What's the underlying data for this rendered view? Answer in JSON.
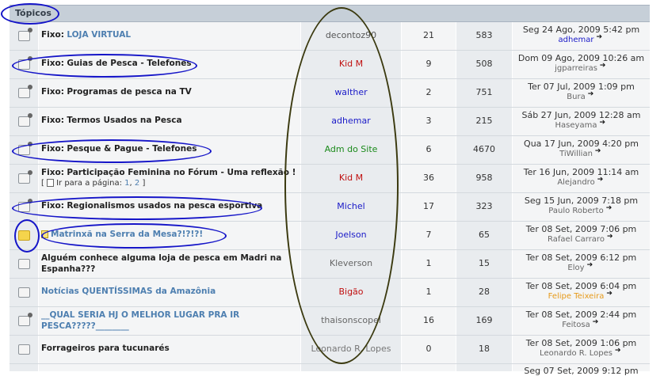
{
  "header": {
    "title": "Tópicos"
  },
  "rows": [
    {
      "prefix": "Fixo:",
      "title": "LOJA VIRTUAL",
      "title_color": "#4e7fb0",
      "author": "decontoz90",
      "author_color": "#555555",
      "replies": "21",
      "views": "583",
      "date": "Seg 24 Ago, 2009 5:42 pm",
      "last_user": "adhemar",
      "last_user_color": "#1a1ac8"
    },
    {
      "prefix": "Fixo:",
      "title": "Guias de Pesca - Telefones",
      "title_color": "#222222",
      "author": "Kid M",
      "author_color": "#c01010",
      "replies": "9",
      "views": "508",
      "date": "Dom 09 Ago, 2009 10:26 am",
      "last_user": "jgparreiras",
      "last_user_color": "#666666"
    },
    {
      "prefix": "Fixo:",
      "title": "Programas de pesca na TV",
      "title_color": "#222222",
      "author": "walther",
      "author_color": "#1a1ac8",
      "replies": "2",
      "views": "751",
      "date": "Ter 07 Jul, 2009 1:09 pm",
      "last_user": "Bura",
      "last_user_color": "#666666"
    },
    {
      "prefix": "Fixo:",
      "title": "Termos Usados na Pesca",
      "title_color": "#222222",
      "author": "adhemar",
      "author_color": "#1a1ac8",
      "replies": "3",
      "views": "215",
      "date": "Sáb 27 Jun, 2009 12:28 am",
      "last_user": "Haseyama",
      "last_user_color": "#666666"
    },
    {
      "prefix": "Fixo:",
      "title": "Pesque & Pague - Telefones",
      "title_color": "#222222",
      "author": "Adm do Site",
      "author_color": "#1a8a1a",
      "replies": "6",
      "views": "4670",
      "date": "Qua 17 Jun, 2009 4:20 pm",
      "last_user": "TiWillian",
      "last_user_color": "#666666"
    },
    {
      "prefix": "Fixo:",
      "title": "Participação Feminina no Fórum - Uma reflexão !",
      "title_color": "#222222",
      "pages_label": "[ ",
      "pages_text": "Ir para a página:",
      "page1": "1",
      "page2": "2",
      "pages_end": " ]",
      "author": "Kid M",
      "author_color": "#c01010",
      "replies": "36",
      "views": "958",
      "date": "Ter 16 Jun, 2009 11:14 am",
      "last_user": "Alejandro",
      "last_user_color": "#666666"
    },
    {
      "prefix": "Fixo:",
      "title": "Regionalismos usados na pesca esportiva",
      "title_color": "#222222",
      "author": "Michel",
      "author_color": "#1a1ac8",
      "replies": "17",
      "views": "323",
      "date": "Seg 15 Jun, 2009 7:18 pm",
      "last_user": "Paulo Roberto",
      "last_user_color": "#666666"
    },
    {
      "prefix": "",
      "title": "Matrinxã na Serra da Mesa?!?!?!",
      "title_color": "#4e7fb0",
      "author": "Joelson",
      "author_color": "#1a1ac8",
      "replies": "7",
      "views": "65",
      "date": "Ter 08 Set, 2009 7:06 pm",
      "last_user": "Rafael Carraro",
      "last_user_color": "#666666"
    },
    {
      "prefix": "",
      "title": "Alguém conhece alguma loja de pesca em Madri na",
      "title2": "Espanha???",
      "title_color": "#222222",
      "author": "Kleverson",
      "author_color": "#666666",
      "replies": "1",
      "views": "15",
      "date": "Ter 08 Set, 2009 6:12 pm",
      "last_user": "Eloy",
      "last_user_color": "#666666"
    },
    {
      "prefix": "",
      "title": "Notícias QUENTÍSSIMAS da Amazônia",
      "title_color": "#4e7fb0",
      "author": "Bigão",
      "author_color": "#c01010",
      "replies": "1",
      "views": "28",
      "date": "Ter 08 Set, 2009 6:04 pm",
      "last_user": "Felipe Teixeira",
      "last_user_color": "#e69a1a"
    },
    {
      "prefix": "",
      "title": "__QUAL SERIA HJ O MELHOR LUGAR PRA IR",
      "title2": "PESCA?????________",
      "title_color": "#4e7fb0",
      "author": "thaisonscopel",
      "author_color": "#666666",
      "replies": "16",
      "views": "169",
      "date": "Ter 08 Set, 2009 2:44 pm",
      "last_user": "Feitosa",
      "last_user_color": "#666666"
    },
    {
      "prefix": "",
      "title": "Forrageiros para tucunarés",
      "title_color": "#222222",
      "author": "Leonardo R. Lopes",
      "author_color": "#777777",
      "replies": "0",
      "views": "18",
      "date": "Ter 08 Set, 2009 1:06 pm",
      "last_user": "Leonardo R. Lopes",
      "last_user_color": "#666666"
    },
    {
      "date": "Seg 07 Set, 2009 9:12 pm"
    }
  ]
}
